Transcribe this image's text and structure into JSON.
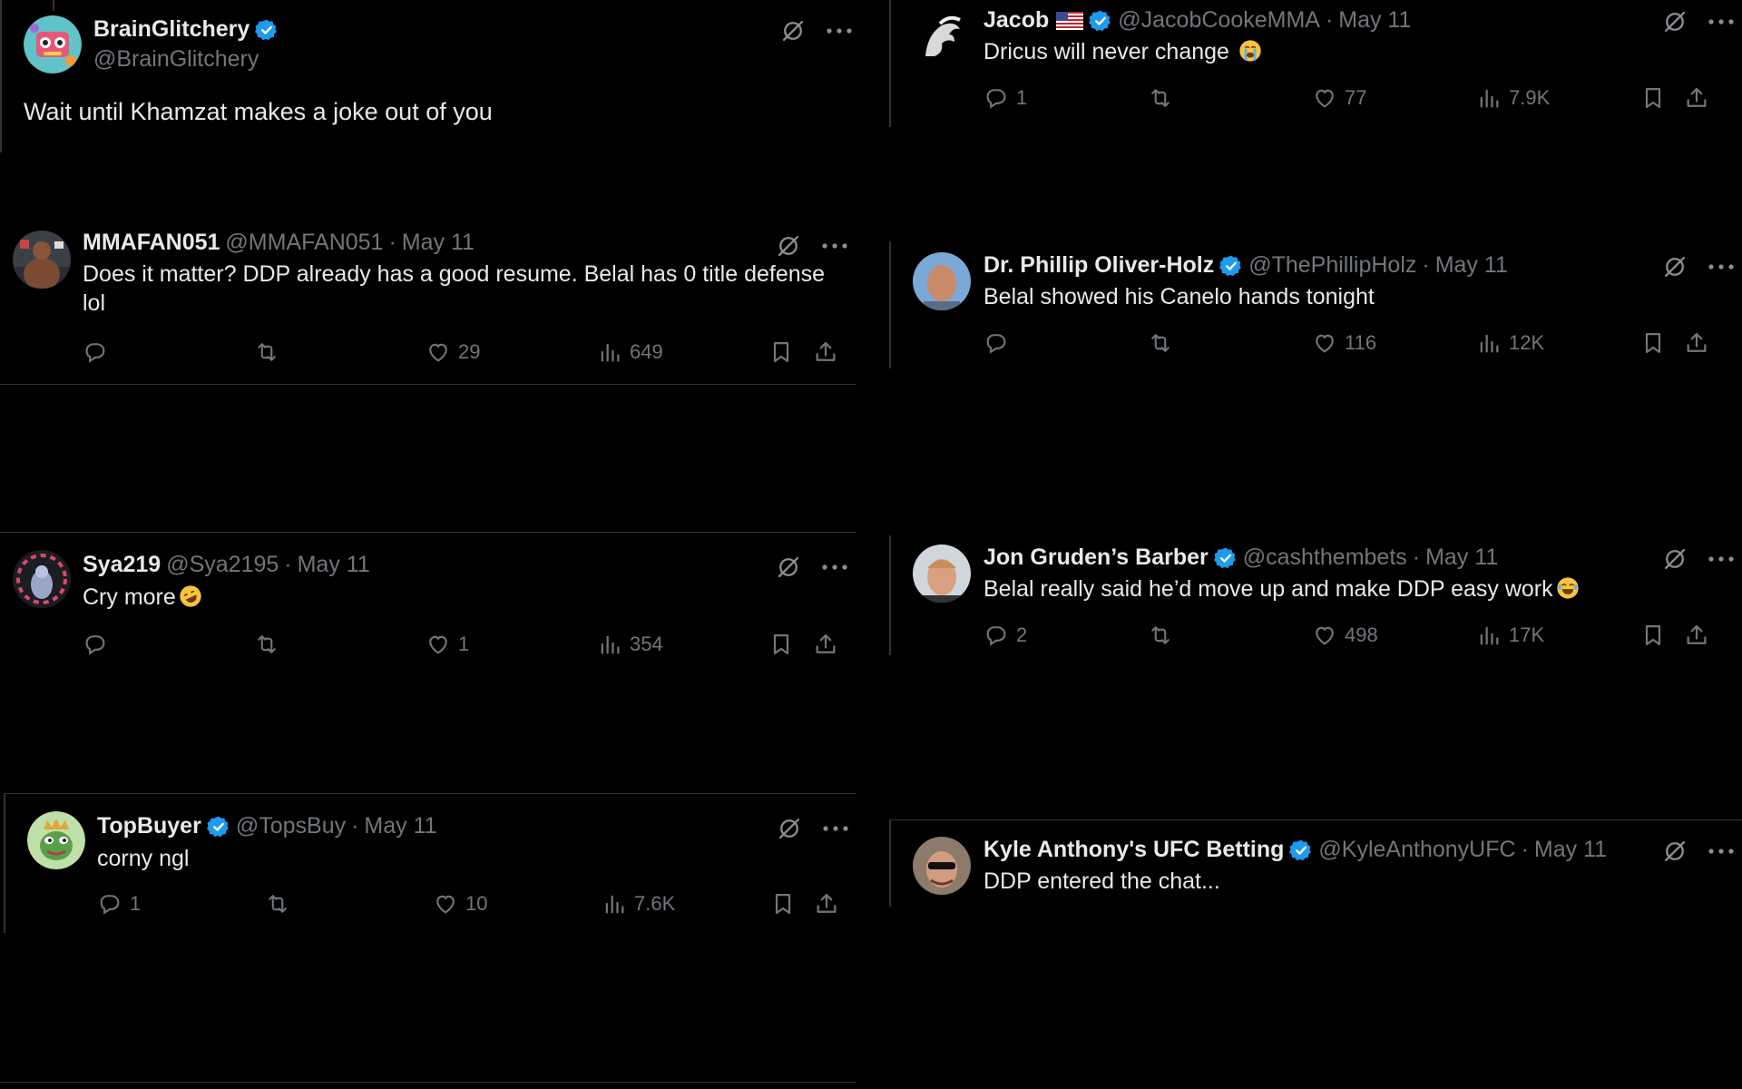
{
  "tweets": {
    "brain": {
      "name": "BrainGlitchery",
      "handle": "@BrainGlitchery",
      "text": "Wait until Khamzat makes a joke out of you"
    },
    "mmafan": {
      "name": "MMAFAN051",
      "handle": "@MMAFAN051",
      "date": "May 11",
      "text_line1": "Does it matter? DDP already has a good resume. Belal has 0 title defense",
      "text_line2": "lol",
      "likes": "29",
      "views": "649"
    },
    "sya": {
      "name": "Sya219",
      "handle": "@Sya2195",
      "date": "May 11",
      "text": "Cry more",
      "likes": "1",
      "views": "354"
    },
    "topbuyer": {
      "name": "TopBuyer",
      "handle": "@TopsBuy",
      "date": "May 11",
      "text": "corny ngl",
      "replies": "1",
      "likes": "10",
      "views": "7.6K"
    },
    "jacob": {
      "name": "Jacob",
      "handle": "@JacobCookeMMA",
      "date": "May 11",
      "text": "Dricus will never change",
      "replies": "1",
      "likes": "77",
      "views": "7.9K"
    },
    "phillip": {
      "name": "Dr. Phillip Oliver-Holz",
      "handle": "@ThePhillipHolz",
      "date": "May 11",
      "text": "Belal showed his Canelo hands tonight",
      "likes": "116",
      "views": "12K"
    },
    "gruden": {
      "name": "Jon Gruden’s Barber",
      "handle": "@cashthembets",
      "date": "May 11",
      "text": "Belal really said he’d move up and make DDP easy work",
      "replies": "2",
      "likes": "498",
      "views": "17K"
    },
    "kyle": {
      "name": "Kyle Anthony's UFC Betting",
      "handle": "@KyleAnthonyUFC",
      "date": "May 11",
      "text": "DDP entered the chat..."
    }
  },
  "separator": "·",
  "colors": {
    "background": "#000000",
    "text": "#e7e9ea",
    "muted": "#71767b",
    "verified": "#1d9bf0",
    "divider": "#2f3336"
  },
  "icons": [
    "grok-icon",
    "more-icon",
    "reply-icon",
    "retweet-icon",
    "like-icon",
    "views-icon",
    "bookmark-icon",
    "share-icon",
    "verified-badge-icon",
    "us-flag-icon"
  ]
}
